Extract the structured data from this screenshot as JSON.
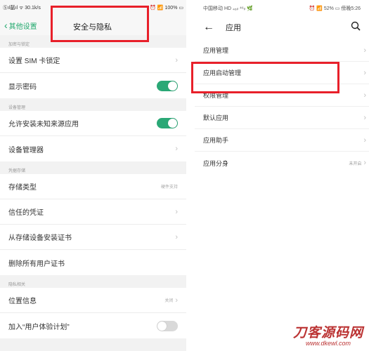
{
  "left_phone": {
    "status": {
      "carrier": "Ⓢıl嚭ıl ᯤ 30.1k/s",
      "right": "⏰ 📶 100% ▭"
    },
    "nav": {
      "back_label": "其他设置",
      "title": "安全与隐私"
    },
    "sections": [
      {
        "header": "加密与锁定",
        "rows": [
          {
            "label": "设置 SIM 卡锁定",
            "control": "arrow"
          },
          {
            "label": "显示密码",
            "control": "toggle",
            "on": true
          }
        ]
      },
      {
        "header": "设备管理",
        "rows": [
          {
            "label": "允许安装未知来源应用",
            "control": "toggle",
            "on": true
          },
          {
            "label": "设备管理器",
            "control": "arrow"
          }
        ]
      },
      {
        "header": "凭据存储",
        "rows": [
          {
            "label": "存储类型",
            "control": "value",
            "value": "硬件支持"
          },
          {
            "label": "信任的凭证",
            "control": "arrow"
          },
          {
            "label": "从存储设备安装证书",
            "control": "arrow"
          },
          {
            "label": "删除所有用户证书",
            "control": "none"
          }
        ]
      },
      {
        "header": "隐私相关",
        "rows": [
          {
            "label": "位置信息",
            "control": "value-arrow",
            "value": "关闭"
          },
          {
            "label": "加入“用户体验计划”",
            "control": "toggle",
            "on": false
          }
        ]
      }
    ]
  },
  "right_phone": {
    "status": {
      "left": "中国移动 HD ₄₆ᵢₗ ⁴⁶ᵢₗ 🌿",
      "right": "⏰ 📶 52% ▭ 傍晚5:26"
    },
    "nav": {
      "title": "应用"
    },
    "rows": [
      {
        "label": "应用管理"
      },
      {
        "label": "应用启动管理"
      },
      {
        "label": "权限管理"
      },
      {
        "label": "默认应用"
      },
      {
        "label": "应用助手"
      },
      {
        "label": "应用分身",
        "value": "未开启"
      }
    ]
  },
  "watermark": {
    "main": "刀客源码网",
    "sub": "www.dkewl.com"
  },
  "colors": {
    "accent_green": "#20a86c",
    "highlight_red": "#e8202a"
  }
}
